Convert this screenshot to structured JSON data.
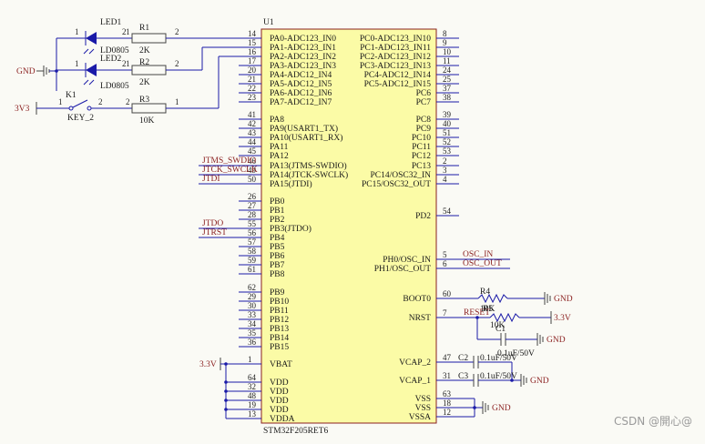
{
  "chip": {
    "ref": "U1",
    "part": "STM32F205RET6",
    "colors": {
      "body_fill": "#fbfba6",
      "body_stroke": "#8a2020",
      "wire": "#1a1aa8",
      "label": "#8a1f1f"
    },
    "left_pins": [
      {
        "num": "14",
        "name": "PA0-ADC123_IN0"
      },
      {
        "num": "15",
        "name": "PA1-ADC123_IN1"
      },
      {
        "num": "16",
        "name": "PA2-ADC123_IN2"
      },
      {
        "num": "17",
        "name": "PA3-ADC123_IN3"
      },
      {
        "num": "20",
        "name": "PA4-ADC12_IN4"
      },
      {
        "num": "21",
        "name": "PA5-ADC12_IN5"
      },
      {
        "num": "22",
        "name": "PA6-ADC12_IN6"
      },
      {
        "num": "23",
        "name": "PA7-ADC12_IN7"
      },
      {
        "num": "41",
        "name": "PA8"
      },
      {
        "num": "42",
        "name": "PA9(USART1_TX)"
      },
      {
        "num": "43",
        "name": "PA10(USART1_RX)"
      },
      {
        "num": "44",
        "name": "PA11"
      },
      {
        "num": "45",
        "name": "PA12"
      },
      {
        "num": "46",
        "name": "PA13(JTMS-SWDIO)"
      },
      {
        "num": "49",
        "name": "PA14(JTCK-SWCLK)"
      },
      {
        "num": "50",
        "name": "PA15(JTDI)"
      },
      {
        "num": "26",
        "name": "PB0"
      },
      {
        "num": "27",
        "name": "PB1"
      },
      {
        "num": "28",
        "name": "PB2"
      },
      {
        "num": "55",
        "name": "PB3(JTDO)"
      },
      {
        "num": "56",
        "name": "PB4"
      },
      {
        "num": "57",
        "name": "PB5"
      },
      {
        "num": "58",
        "name": "PB6"
      },
      {
        "num": "59",
        "name": "PB7"
      },
      {
        "num": "61",
        "name": "PB8"
      },
      {
        "num": "62",
        "name": "PB9"
      },
      {
        "num": "29",
        "name": "PB10"
      },
      {
        "num": "30",
        "name": "PB11"
      },
      {
        "num": "33",
        "name": "PB12"
      },
      {
        "num": "34",
        "name": "PB13"
      },
      {
        "num": "35",
        "name": "PB14"
      },
      {
        "num": "36",
        "name": "PB15"
      },
      {
        "num": "1",
        "name": "VBAT"
      },
      {
        "num": "64",
        "name": "VDD"
      },
      {
        "num": "32",
        "name": "VDD"
      },
      {
        "num": "48",
        "name": "VDD"
      },
      {
        "num": "19",
        "name": "VDD"
      },
      {
        "num": "13",
        "name": "VDDA"
      }
    ],
    "right_pins": [
      {
        "num": "8",
        "name": "PC0-ADC123_IN10"
      },
      {
        "num": "9",
        "name": "PC1-ADC123_IN11"
      },
      {
        "num": "10",
        "name": "PC2-ADC123_IN12"
      },
      {
        "num": "11",
        "name": "PC3-ADC123_IN13"
      },
      {
        "num": "24",
        "name": "PC4-ADC12_IN14"
      },
      {
        "num": "25",
        "name": "PC5-ADC12_IN15"
      },
      {
        "num": "37",
        "name": "PC6"
      },
      {
        "num": "38",
        "name": "PC7"
      },
      {
        "num": "39",
        "name": "PC8"
      },
      {
        "num": "40",
        "name": "PC9"
      },
      {
        "num": "51",
        "name": "PC10"
      },
      {
        "num": "52",
        "name": "PC11"
      },
      {
        "num": "53",
        "name": "PC12"
      },
      {
        "num": "2",
        "name": "PC13"
      },
      {
        "num": "3",
        "name": "PC14/OSC32_IN"
      },
      {
        "num": "4",
        "name": "PC15/OSC32_OUT"
      },
      {
        "num": "54",
        "name": "PD2"
      },
      {
        "num": "5",
        "name": "PH0/OSC_IN"
      },
      {
        "num": "6",
        "name": "PH1/OSC_OUT"
      },
      {
        "num": "60",
        "name": "BOOT0"
      },
      {
        "num": "7",
        "name": "NRST"
      },
      {
        "num": "47",
        "name": "VCAP_2"
      },
      {
        "num": "31",
        "name": "VCAP_1"
      },
      {
        "num": "63",
        "name": "VSS"
      },
      {
        "num": "18",
        "name": "VSS"
      },
      {
        "num": "12",
        "name": "VSSA"
      }
    ]
  },
  "components": {
    "led1": {
      "ref": "LED1",
      "value": "LD0805",
      "pin_a": "2",
      "pin_k": "1"
    },
    "led2": {
      "ref": "LED2",
      "value": "LD0805",
      "pin_a": "2",
      "pin_k": "1"
    },
    "r1": {
      "ref": "R1",
      "value": "2K",
      "pin1": "1",
      "pin2": "2"
    },
    "r2": {
      "ref": "R2",
      "value": "2K",
      "pin1": "1",
      "pin2": "2"
    },
    "r3": {
      "ref": "R3",
      "value": "10K",
      "pin1": "2",
      "pin2": "1"
    },
    "k1": {
      "ref": "K1",
      "value": "KEY_2",
      "pin1": "1",
      "pin2": "2"
    },
    "r4": {
      "ref": "R4",
      "value": "10K"
    },
    "r5": {
      "ref": "R5",
      "value": "10K"
    },
    "c1": {
      "ref": "C1",
      "value": "0.1uF/50V"
    },
    "c2": {
      "ref": "C2",
      "value": "0.1uF/50V"
    },
    "c3": {
      "ref": "C3",
      "value": "0.1uF/50V"
    }
  },
  "nets": {
    "gnd": "GND",
    "v3v3": "3V3",
    "v33": "3.3V",
    "jtms": "JTMS_SWDIO",
    "jtck": "JTCK_SWCLK",
    "jtdi": "JTDI",
    "jtdo": "JTDO",
    "jtrst": "JTRST",
    "osc_in": "OSC_IN",
    "osc_out": "OSC_OUT",
    "reset": "RESET"
  },
  "watermark": "CSDN @開心@"
}
